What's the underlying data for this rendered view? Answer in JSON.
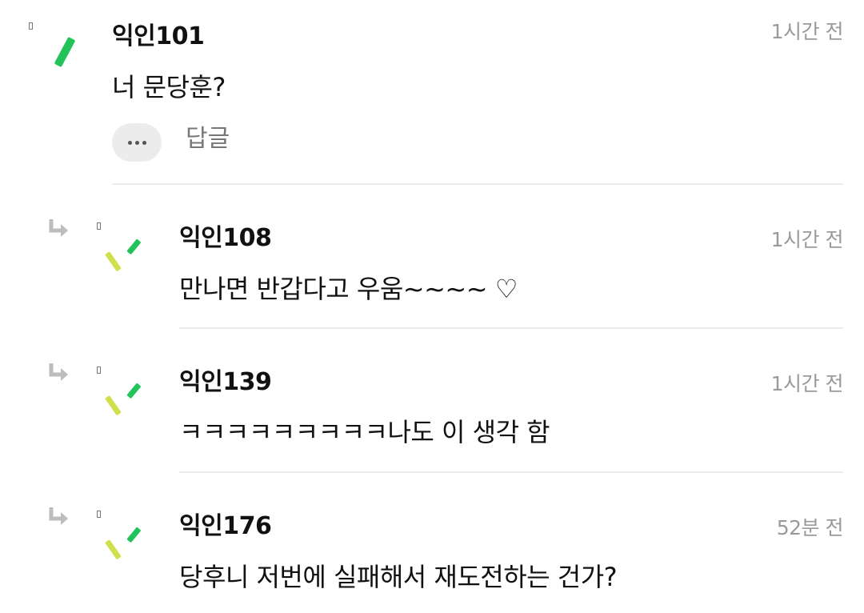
{
  "comments": [
    {
      "name": "익인101",
      "time": "1시간 전",
      "text": "너 문당훈?",
      "actions": {
        "more_icon": "more-horizontal-icon",
        "reply_label": "답글"
      }
    },
    {
      "name": "익인108",
      "time": "1시간 전",
      "text": "만나면 반갑다고 우움~~~~ ♡"
    },
    {
      "name": "익인139",
      "time": "1시간 전",
      "text": "ㅋㅋㅋㅋㅋㅋㅋㅋㅋ나도 이 생각 함"
    },
    {
      "name": "익인176",
      "time": "52분 전",
      "text": "당후니 저번에 실패해서 재도전하는 건가?"
    }
  ],
  "colors": {
    "name": "#111111",
    "time": "#9a9a9a",
    "divider": "#ececec",
    "avatar_green": "#22c45a",
    "avatar_lime": "#cfe04a",
    "reply_arrow": "#bdbdbd"
  },
  "icons": {
    "reply_indent": "reply-arrow-icon",
    "avatar": "anonymous-avatar-icon"
  }
}
